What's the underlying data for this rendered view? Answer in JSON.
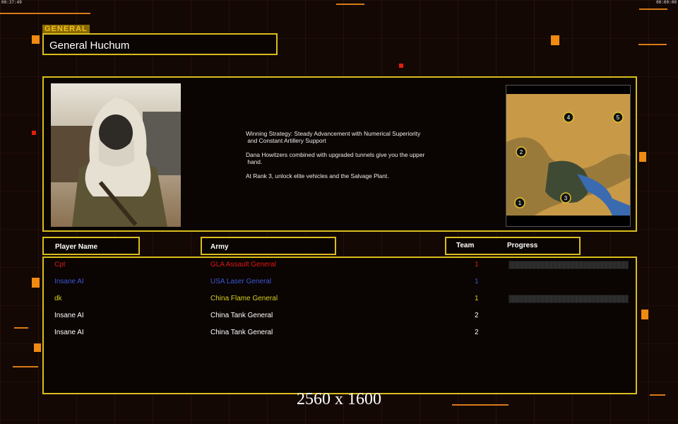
{
  "status": {
    "left_timer": "00:37:49",
    "right_timer": "00:00:00"
  },
  "general": {
    "tag": "GENERAL",
    "name": "General Huchum"
  },
  "description": [
    "Winning Strategy: Steady Advancement with Numerical Superiority\n and Constant Artillery Support",
    "Dana Howitzers combined with upgraded tunnels give you the upper\n hand.",
    "At Rank 3, unlock elite vehicles and the Salvage Plant."
  ],
  "map": {
    "start_positions": [
      "1",
      "2",
      "3",
      "4",
      "5"
    ]
  },
  "table": {
    "headers": {
      "player": "Player Name",
      "army": "Army",
      "team": "Team",
      "progress": "Progress"
    },
    "rows": [
      {
        "player": "Cpt",
        "army": "GLA Assault General",
        "team": "1",
        "color": "#e01818",
        "progress_bar": true
      },
      {
        "player": "Insane AI",
        "army": "USA Laser General",
        "team": "1",
        "color": "#3a58d8",
        "progress_bar": false
      },
      {
        "player": "dk",
        "army": "China Flame General",
        "team": "1",
        "color": "#d8d020",
        "progress_bar": true
      },
      {
        "player": "Insane AI",
        "army": "China Tank General",
        "team": "2",
        "color": "#ffffff",
        "progress_bar": false
      },
      {
        "player": "Insane AI",
        "army": "China Tank General",
        "team": "2",
        "color": "#ffffff",
        "progress_bar": false
      }
    ]
  },
  "overlay": {
    "resolution": "2560 x 1600"
  }
}
